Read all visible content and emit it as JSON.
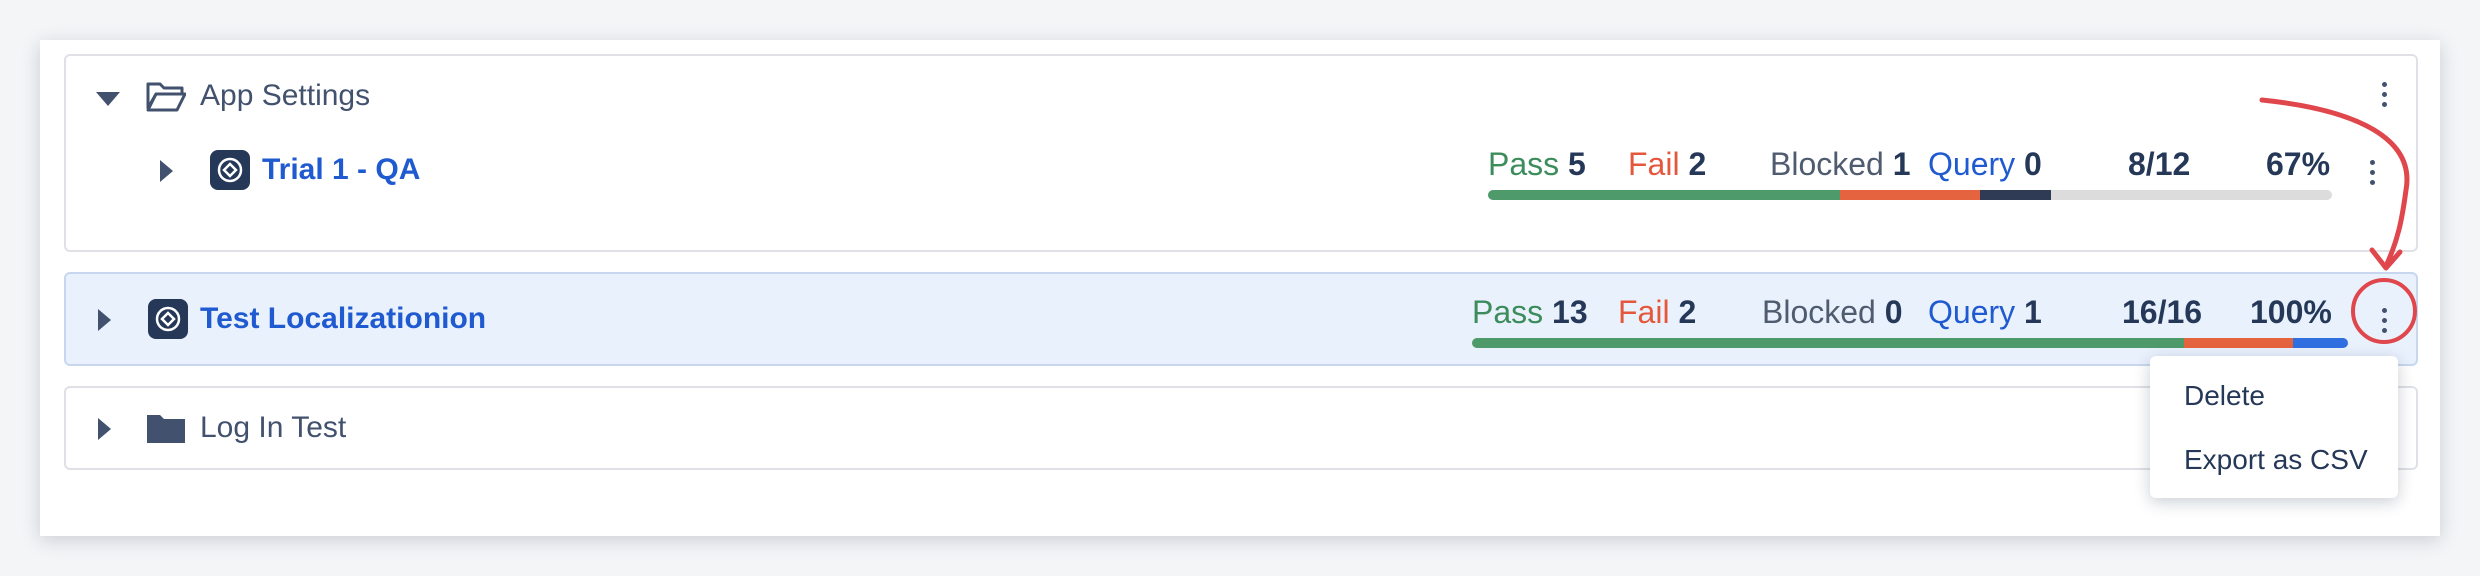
{
  "rows": [
    {
      "kind": "folder",
      "title": "App Settings",
      "expanded": true,
      "icon": "folder-open-icon",
      "children": [
        {
          "kind": "suite",
          "title": "Trial 1 - QA",
          "expanded": false,
          "icon": "suite-icon",
          "stats": {
            "pass_label": "Pass",
            "pass": "5",
            "fail_label": "Fail",
            "fail": "2",
            "blocked_label": "Blocked",
            "blocked": "1",
            "query_label": "Query",
            "query": "0",
            "ratio": "8/12",
            "percent": "67%"
          },
          "progress": {
            "pass": 5,
            "fail": 2,
            "blocked": 1,
            "query": 0,
            "total": 12
          }
        }
      ]
    },
    {
      "kind": "suite",
      "title": "Test Localizationion",
      "expanded": false,
      "selected": true,
      "icon": "suite-icon",
      "stats": {
        "pass_label": "Pass",
        "pass": "13",
        "fail_label": "Fail",
        "fail": "2",
        "blocked_label": "Blocked",
        "blocked": "0",
        "query_label": "Query",
        "query": "1",
        "ratio": "16/16",
        "percent": "100%"
      },
      "progress": {
        "pass": 13,
        "fail": 2,
        "blocked": 0,
        "query": 1,
        "total": 16
      }
    },
    {
      "kind": "folder",
      "title": "Log In Test",
      "expanded": false,
      "icon": "folder-icon"
    }
  ],
  "context_menu": {
    "items": [
      "Delete",
      "Export as CSV"
    ]
  },
  "colors": {
    "pass": "#4f9a6b",
    "fail": "#e5633f",
    "blocked": "#2f3b55",
    "query": "#2f6fe0",
    "track": "#dcdcdc",
    "annotation": "#e0474c"
  }
}
